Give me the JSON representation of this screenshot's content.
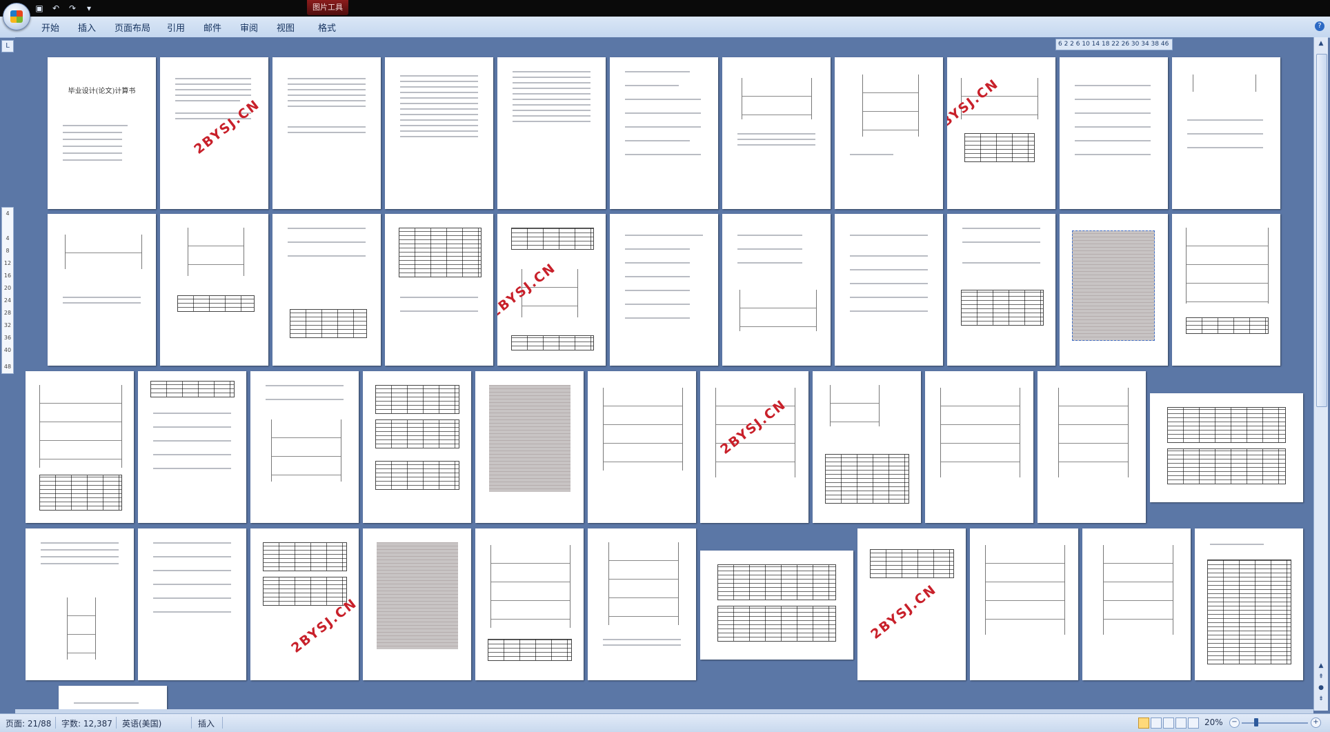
{
  "title_bar": {
    "context_tab": "图片工具",
    "quick_access": [
      "save-icon",
      "undo-icon",
      "redo-icon",
      "customize-icon"
    ]
  },
  "ribbon": {
    "tabs": [
      "开始",
      "插入",
      "页面布局",
      "引用",
      "邮件",
      "审阅",
      "视图",
      "格式"
    ]
  },
  "ruler": {
    "corner_label": "L",
    "vertical_marks": [
      "4",
      "4",
      "8",
      "12",
      "16",
      "20",
      "24",
      "28",
      "32",
      "36",
      "40",
      "48"
    ]
  },
  "page_strip": "6 2 2 6 10 14 18 22 26 30 34 38 46",
  "cover_page": {
    "title": "毕业设计(论文)计算书"
  },
  "watermark": "2BYSJ.CN",
  "status": {
    "page": "页面: 21/88",
    "words": "字数: 12,387",
    "language": "英语(美国)",
    "mode": "插入",
    "zoom": "20%"
  }
}
